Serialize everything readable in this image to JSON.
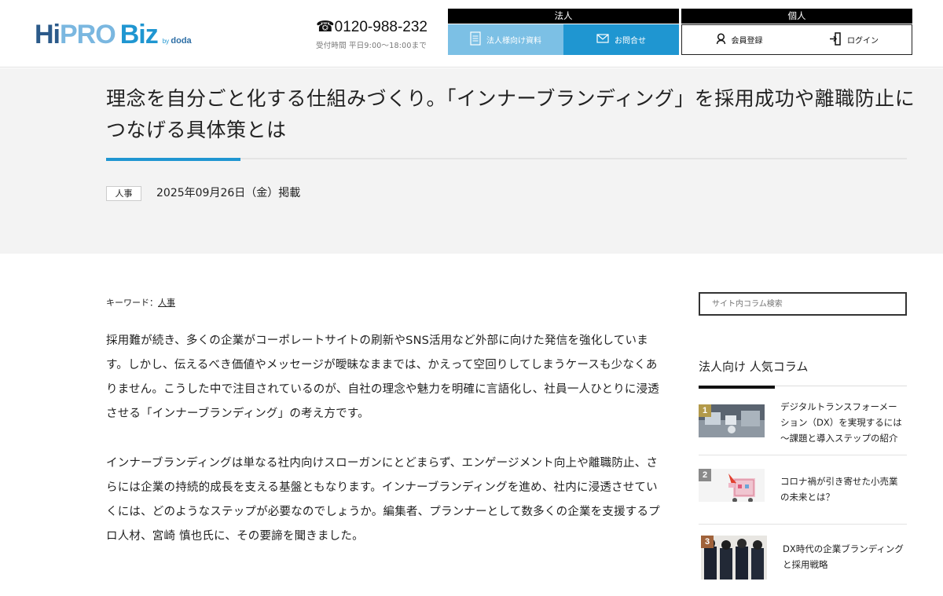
{
  "header": {
    "logo": {
      "part1": "Hi",
      "part2": "PRO",
      "part3": "Biz",
      "by": "by",
      "parent": "doda"
    },
    "phone": {
      "number": "☎0120-988-232",
      "hours": "受付時間 平日9:00〜18:00まで"
    },
    "groups": {
      "corporate": "法人",
      "individual": "個人"
    },
    "buttons": {
      "docs": "法人様向け資料",
      "contact": "お問合せ",
      "register": "会員登録",
      "login": "ログイン"
    }
  },
  "article": {
    "title": "理念を自分ごと化する仕組みづくり。「インナーブランディング」を採用成功や離職防止につなげる具体策とは",
    "category": "人事",
    "date": "2025年09月26日（金）掲載",
    "keyword_label": "キーワード：",
    "keyword": "人事",
    "paragraphs": [
      "採用難が続き、多くの企業がコーポレートサイトの刷新やSNS活用など外部に向けた発信を強化しています。しかし、伝えるべき価値やメッセージが曖昧なままでは、かえって空回りしてしまうケースも少なくありません。こうした中で注目されているのが、自社の理念や魅力を明確に言語化し、社員一人ひとりに浸透させる「インナーブランディング」の考え方です。",
      "インナーブランディングは単なる社内向けスローガンにとどまらず、エンゲージメント向上や離職防止、さらには企業の持続的成長を支える基盤ともなります。インナーブランディングを進め、社内に浸透させていくには、どのようなステップが必要なのでしょうか。編集者、プランナーとして数多くの企業を支援するプロ人材、宮崎 慎也氏に、その要諦を聞きました。"
    ]
  },
  "sidebar": {
    "search_placeholder": "サイト内コラム検索",
    "popular_title": "法人向け 人気コラム",
    "ranking": [
      {
        "rank": "1",
        "text": "デジタルトランスフォーメーション（DX）を実現するには～課題と導入ステップの紹介"
      },
      {
        "rank": "2",
        "text": "コロナ禍が引き寄せた小売業の未来とは？"
      },
      {
        "rank": "3",
        "text": "DX時代の企業ブランディングと採用戦略"
      }
    ]
  },
  "colors": {
    "brand_blue": "#1f96d1",
    "light_blue": "#7cc0e5",
    "title_band": "#f3f3f3",
    "rank1": "#b39a4a",
    "rank2": "#8a8a8a",
    "rank3": "#a0623a"
  }
}
